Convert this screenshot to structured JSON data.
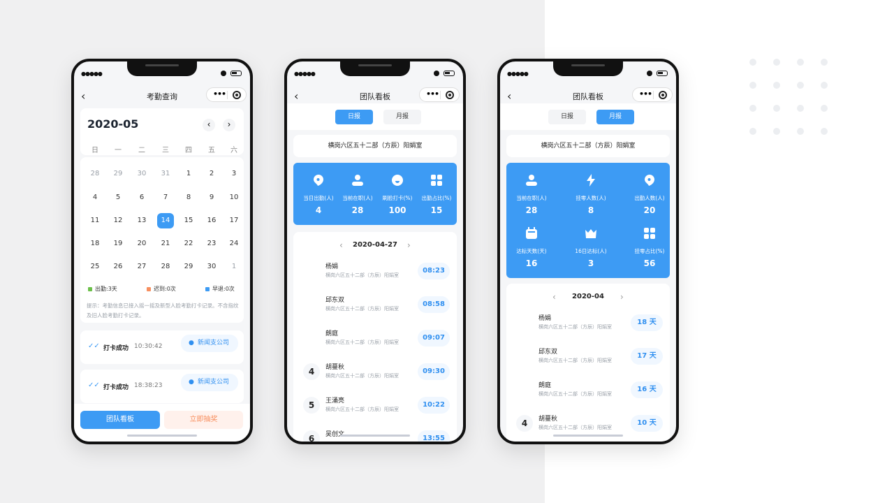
{
  "colors": {
    "accent": "#3d9bf4",
    "attend": "#6cc04a",
    "late": "#f78f5f",
    "early": "#3d9bf4",
    "gold": "#d9a877",
    "silver": "#b8b3ad",
    "bronze": "#a8968a"
  },
  "status_signal": "●●●●●",
  "query": {
    "title": "考勤查询",
    "month": "2020-05",
    "prev": "‹",
    "next": "›",
    "weekdays": [
      "日",
      "一",
      "二",
      "三",
      "四",
      "五",
      "六"
    ],
    "days": [
      [
        {
          "d": "28",
          "o": true
        },
        {
          "d": "29",
          "o": true
        },
        {
          "d": "30",
          "o": true
        },
        {
          "d": "31",
          "o": true
        },
        {
          "d": "1",
          "dot": true
        },
        {
          "d": "2",
          "dot": true
        },
        {
          "d": "3"
        }
      ],
      [
        {
          "d": "4"
        },
        {
          "d": "5",
          "dot": true
        },
        {
          "d": "6",
          "dot": true
        },
        {
          "d": "7",
          "dot": true
        },
        {
          "d": "8",
          "dot": true
        },
        {
          "d": "9",
          "dot": true
        },
        {
          "d": "10"
        }
      ],
      [
        {
          "d": "11"
        },
        {
          "d": "12",
          "dot": true
        },
        {
          "d": "13",
          "dot": true
        },
        {
          "d": "14",
          "sel": true
        },
        {
          "d": "15"
        },
        {
          "d": "16"
        },
        {
          "d": "17"
        }
      ],
      [
        {
          "d": "18"
        },
        {
          "d": "19"
        },
        {
          "d": "20"
        },
        {
          "d": "21"
        },
        {
          "d": "22"
        },
        {
          "d": "23"
        },
        {
          "d": "24"
        }
      ],
      [
        {
          "d": "25"
        },
        {
          "d": "26"
        },
        {
          "d": "27"
        },
        {
          "d": "28"
        },
        {
          "d": "29"
        },
        {
          "d": "30"
        },
        {
          "d": "1",
          "o": true
        }
      ]
    ],
    "legend": {
      "attend": "出勤:3天",
      "late": "迟到:0次",
      "early": "早退:0次"
    },
    "hint": "提示：考勤信息已接入摇一摇及新型人脸考勤打卡记录。不含指纹及旧人脸考勤打卡记录。",
    "punches": [
      {
        "status": "打卡成功",
        "time": "10:30:42",
        "location": "新闻支公司"
      },
      {
        "status": "打卡成功",
        "time": "18:38:23",
        "location": "新闻支公司"
      }
    ],
    "team_button": "团队看板",
    "lottery_button": "立即抽奖"
  },
  "daily": {
    "title": "团队看板",
    "tabs": [
      "日报",
      "月报"
    ],
    "dept": "横岗六区五十二部（方辰）阳娟室",
    "stats": [
      {
        "icon": "location-icon",
        "label": "当日出勤(人)",
        "value": "4"
      },
      {
        "icon": "user-icon",
        "label": "当前在职(人)",
        "value": "28"
      },
      {
        "icon": "face-icon",
        "label": "刷脸打卡(%)",
        "value": "100"
      },
      {
        "icon": "grid-icon",
        "label": "出勤占比(%)",
        "value": "15"
      }
    ],
    "date": "2020-04-27",
    "prev": "‹",
    "next": "›",
    "rows": [
      {
        "rank": "1",
        "name": "杨娟",
        "dept": "横岗六区五十二部（方辰）阳娟室",
        "value": "08:23"
      },
      {
        "rank": "2",
        "name": "邱东双",
        "dept": "横岗六区五十二部（方辰）阳娟室",
        "value": "08:58"
      },
      {
        "rank": "3",
        "name": "朗庭",
        "dept": "横岗六区五十二部（方辰）阳娟室",
        "value": "09:07"
      },
      {
        "rank": "4",
        "name": "胡蔓秋",
        "dept": "横岗六区五十二部（方辰）阳娟室",
        "value": "09:30"
      },
      {
        "rank": "5",
        "name": "王涌亮",
        "dept": "横岗六区五十二部（方辰）阳娟室",
        "value": "10:22"
      },
      {
        "rank": "6",
        "name": "吴创文",
        "dept": "",
        "value": "13:55"
      }
    ]
  },
  "monthly": {
    "title": "团队看板",
    "tabs": [
      "日报",
      "月报"
    ],
    "dept": "横岗六区五十二部（方辰）阳娟室",
    "stats": [
      {
        "icon": "user-icon",
        "label": "当前在职(人)",
        "value": "28"
      },
      {
        "icon": "lightning-icon",
        "label": "挂零人数(人)",
        "value": "8"
      },
      {
        "icon": "location-icon",
        "label": "出勤人数(人)",
        "value": "20"
      },
      {
        "icon": "calendar-icon",
        "label": "达标天数(天)",
        "value": "16"
      },
      {
        "icon": "crown-icon",
        "label": "16日达标(人)",
        "value": "3"
      },
      {
        "icon": "grid-icon",
        "label": "挂零占比(%)",
        "value": "56"
      }
    ],
    "date": "2020-04",
    "prev": "‹",
    "next": "›",
    "rows": [
      {
        "rank": "1",
        "name": "杨娟",
        "dept": "横岗六区五十二部（方辰）阳娟室",
        "value": "18 天"
      },
      {
        "rank": "2",
        "name": "邱东双",
        "dept": "横岗六区五十二部（方辰）阳娟室",
        "value": "17 天"
      },
      {
        "rank": "3",
        "name": "朗庭",
        "dept": "横岗六区五十二部（方辰）阳娟室",
        "value": "16 天"
      },
      {
        "rank": "4",
        "name": "胡蔓秋",
        "dept": "横岗六区五十二部（方辰）阳娟室",
        "value": "10 天"
      }
    ]
  }
}
